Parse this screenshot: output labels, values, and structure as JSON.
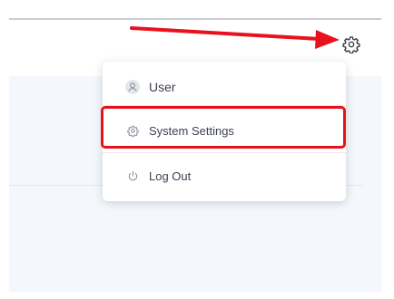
{
  "header": {
    "settings_icon": "gear-icon"
  },
  "user_menu": {
    "items": [
      {
        "label": "User",
        "icon": "user-avatar-icon"
      },
      {
        "label": "System Settings",
        "icon": "gear-icon"
      },
      {
        "label": "Log Out",
        "icon": "power-icon"
      }
    ]
  },
  "annotations": {
    "arrow_color": "#e8121d",
    "highlight_color": "#e8121d",
    "highlighted_item": "System Settings"
  }
}
